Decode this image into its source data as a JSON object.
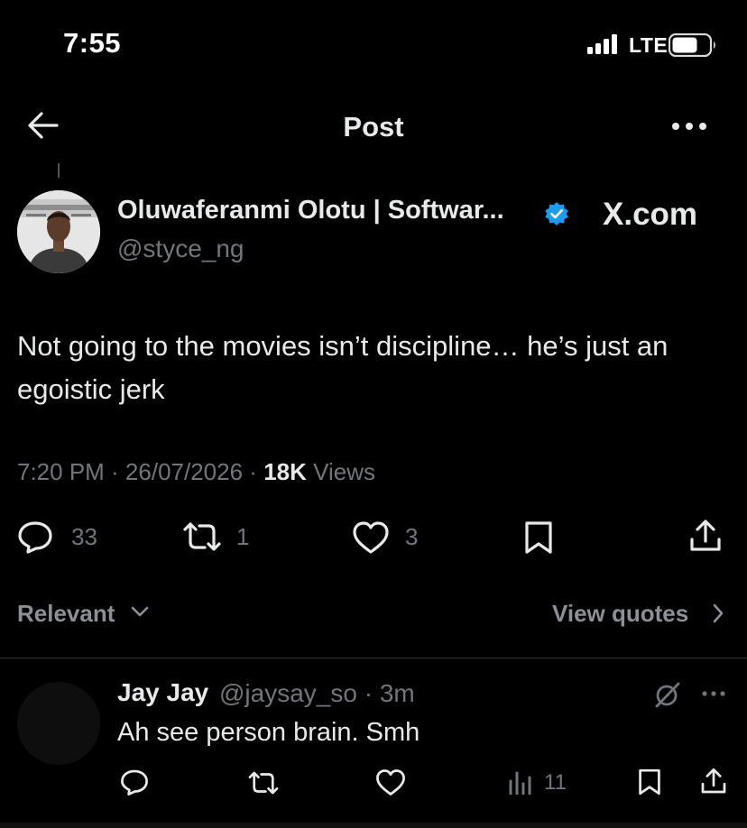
{
  "status_bar": {
    "time": "7:55",
    "network": "LTE",
    "signal_icon": "signal-bars-icon",
    "battery_icon": "battery-icon"
  },
  "nav": {
    "title": "Post",
    "back_icon": "arrow-left-icon",
    "more_icon": "more-horizontal-icon"
  },
  "post": {
    "author_name": "Oluwaferanmi Olotu | Softwar...",
    "verified": true,
    "handle": "@styce_ng",
    "source_label": "X.com",
    "text": "Not going to the movies isn’t discipline… he’s just an egoistic jerk",
    "timestamp": "7:20 PM · 26/07/2026 ·",
    "views_count": "18K",
    "views_label": "Views",
    "replies": "33",
    "reposts": "1",
    "likes": "3"
  },
  "sort": {
    "label": "Relevant",
    "view_quotes": "View quotes"
  },
  "reply": {
    "name": "Jay Jay",
    "handle_time": "@jaysay_so · 3m",
    "text": "Ah see person brain. Smh",
    "views": "11"
  },
  "colors": {
    "background": "#000000",
    "primary_text": "#e7e9ea",
    "secondary_text": "#71767b",
    "verified_blue": "#1d9bf0",
    "divider": "#2f3336"
  }
}
